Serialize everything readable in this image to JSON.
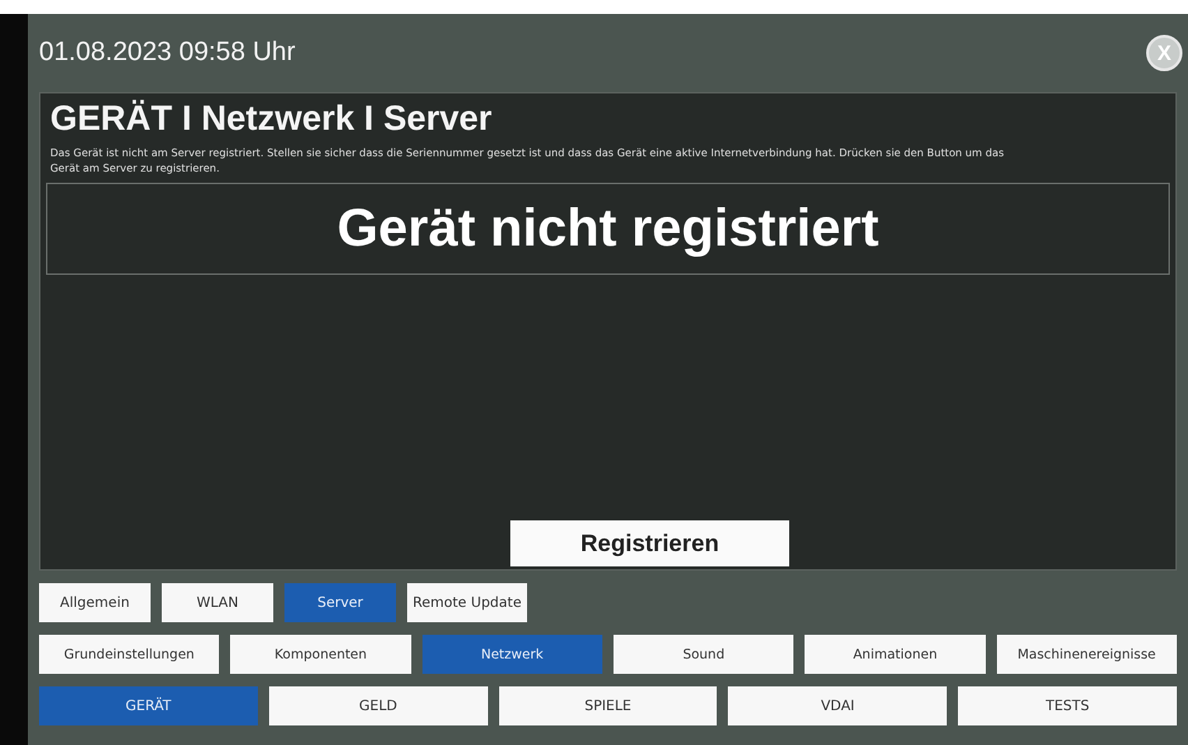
{
  "header": {
    "datetime": "01.08.2023 09:58 Uhr",
    "close": "X"
  },
  "panel": {
    "title": "GERÄT I Netzwerk I Server",
    "description": "Das Gerät ist nicht am Server registriert. Stellen sie sicher dass die Seriennummer gesetzt ist und dass das Gerät eine aktive Internetverbindung hat. Drücken sie den Button um das Gerät am Server zu registrieren.",
    "status": "Gerät nicht registriert",
    "button": "Registrieren"
  },
  "tab_rows": [
    [
      {
        "label": "Allgemein",
        "selected": false
      },
      {
        "label": "WLAN",
        "selected": false
      },
      {
        "label": "Server",
        "selected": true
      },
      {
        "label": "Remote Update",
        "selected": false
      }
    ],
    [
      {
        "label": "Grundeinstellungen",
        "selected": false
      },
      {
        "label": "Komponenten",
        "selected": false
      },
      {
        "label": "Netzwerk",
        "selected": true
      },
      {
        "label": "Sound",
        "selected": false
      },
      {
        "label": "Animationen",
        "selected": false
      },
      {
        "label": "Maschinenereignisse",
        "selected": false
      }
    ],
    [
      {
        "label": "GERÄT",
        "selected": true
      },
      {
        "label": "GELD",
        "selected": false
      },
      {
        "label": "SPIELE",
        "selected": false
      },
      {
        "label": "VDAI",
        "selected": false
      },
      {
        "label": "TESTS",
        "selected": false
      }
    ]
  ]
}
